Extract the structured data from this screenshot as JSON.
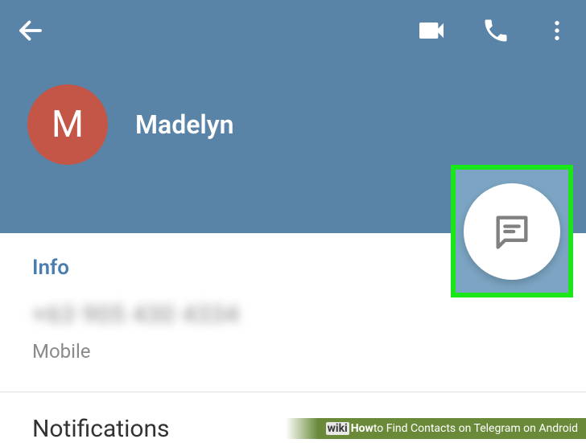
{
  "toolbar": {
    "back": "back",
    "video": "video-call",
    "call": "voice-call",
    "menu": "menu"
  },
  "profile": {
    "initial": "M",
    "name": "Madelyn"
  },
  "info": {
    "title": "Info",
    "phone": "+63 905 430 4334",
    "phone_label": "Mobile"
  },
  "notifications": {
    "title": "Notifications"
  },
  "fab": {
    "action": "message"
  },
  "caption": {
    "brand1": "wiki",
    "brand2": "How",
    "text": " to Find Contacts on Telegram on Android"
  }
}
